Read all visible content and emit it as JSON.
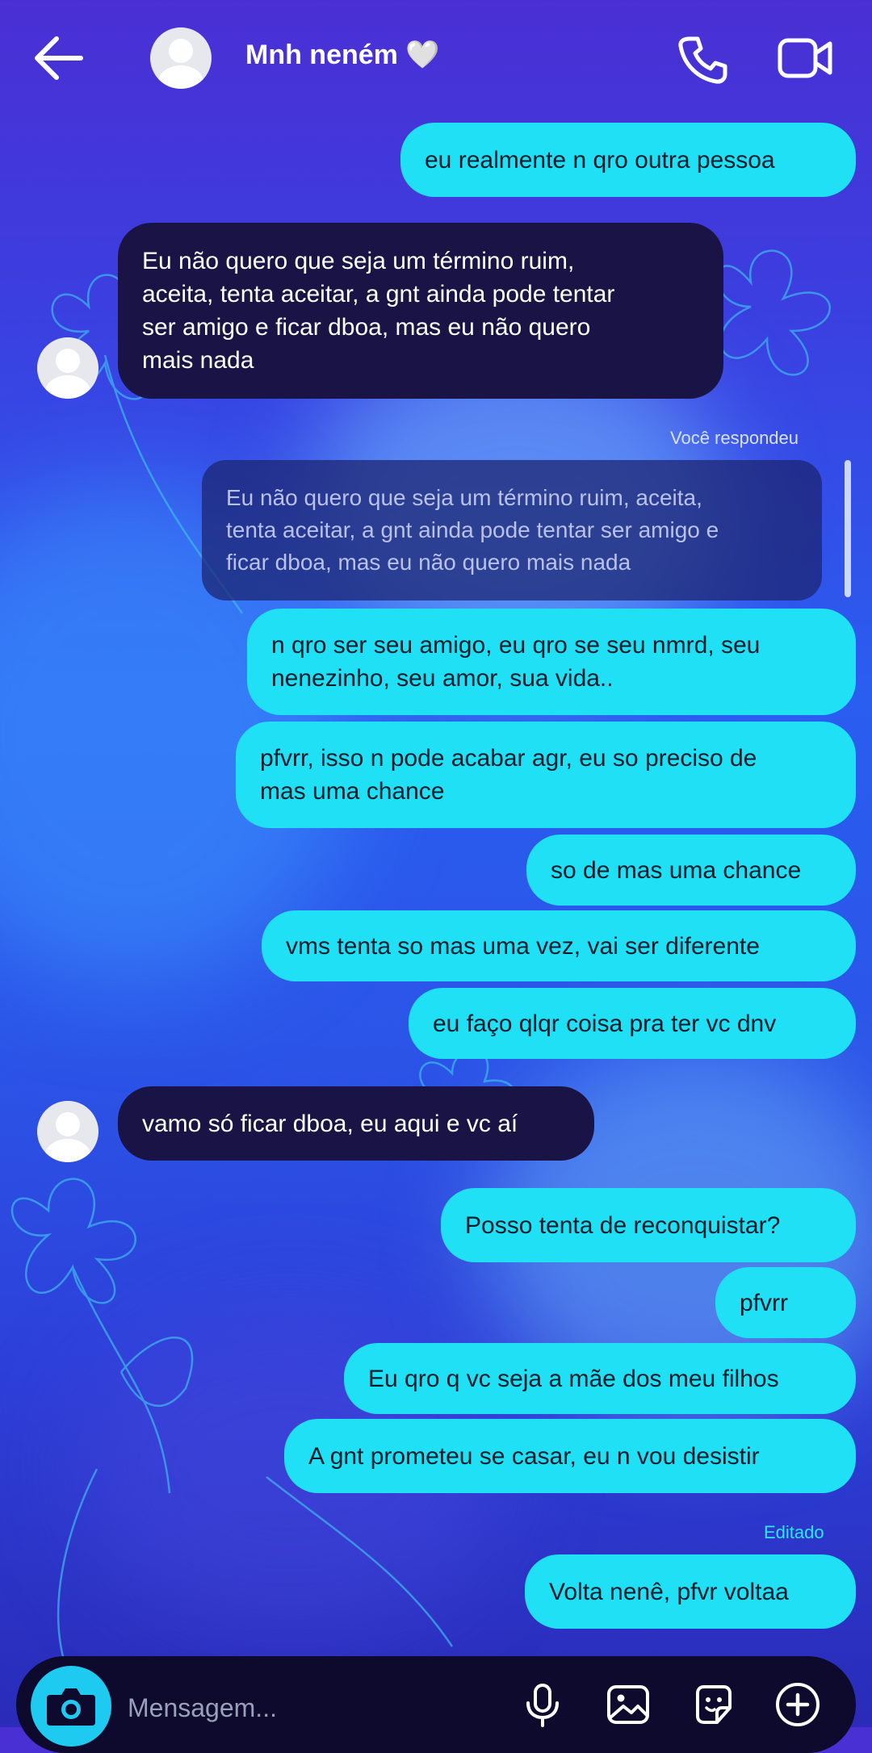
{
  "header": {
    "contact_name": "Mnh neném",
    "heart": "🤍"
  },
  "messages": [
    {
      "side": "out",
      "text": "eu realmente n qro outra pessoa"
    },
    {
      "side": "in",
      "lines": [
        "Eu não quero que seja um término ruim,",
        "aceita, tenta aceitar, a gnt ainda pode tentar",
        "ser amigo e ficar dboa, mas eu não quero",
        "mais nada"
      ]
    },
    {
      "side": "label",
      "text": "Você respondeu"
    },
    {
      "side": "reply",
      "lines": [
        "Eu não quero que seja um término ruim, aceita,",
        "tenta aceitar, a gnt ainda pode tentar ser amigo e",
        "ficar dboa, mas eu não quero mais nada"
      ]
    },
    {
      "side": "out",
      "lines": [
        "n qro ser seu amigo, eu qro se seu nmrd, seu",
        "nenezinho, seu amor, sua vida.."
      ]
    },
    {
      "side": "out",
      "lines": [
        "pfvrr, isso n pode acabar agr, eu so preciso de",
        "mas uma chance"
      ]
    },
    {
      "side": "out",
      "text": "so de mas uma chance"
    },
    {
      "side": "out",
      "text": "vms tenta so mas uma vez, vai ser diferente"
    },
    {
      "side": "out",
      "text": "eu faço qlqr coisa pra ter vc dnv"
    },
    {
      "side": "in",
      "text": "vamo só ficar dboa, eu aqui e vc aí"
    },
    {
      "side": "out",
      "text": "Posso tenta de reconquistar?"
    },
    {
      "side": "out",
      "text": "pfvrr"
    },
    {
      "side": "out",
      "text": "Eu qro q vc seja a mãe dos meu filhos"
    },
    {
      "side": "out",
      "text": "A gnt prometeu se casar, eu n vou desistir"
    },
    {
      "side": "label",
      "text": "Editado"
    },
    {
      "side": "out",
      "text": "Volta nenê, pfvr voltaa"
    }
  ],
  "composer": {
    "placeholder": "Mensagem..."
  },
  "colors": {
    "outgoing_bubble": "#1fe0f5",
    "incoming_bubble": "#1a1446",
    "edited_label": "#2ee6ff"
  },
  "icons": [
    "back-arrow-icon",
    "phone-icon",
    "video-call-icon",
    "camera-icon",
    "microphone-icon",
    "gallery-icon",
    "sticker-icon",
    "plus-icon"
  ]
}
